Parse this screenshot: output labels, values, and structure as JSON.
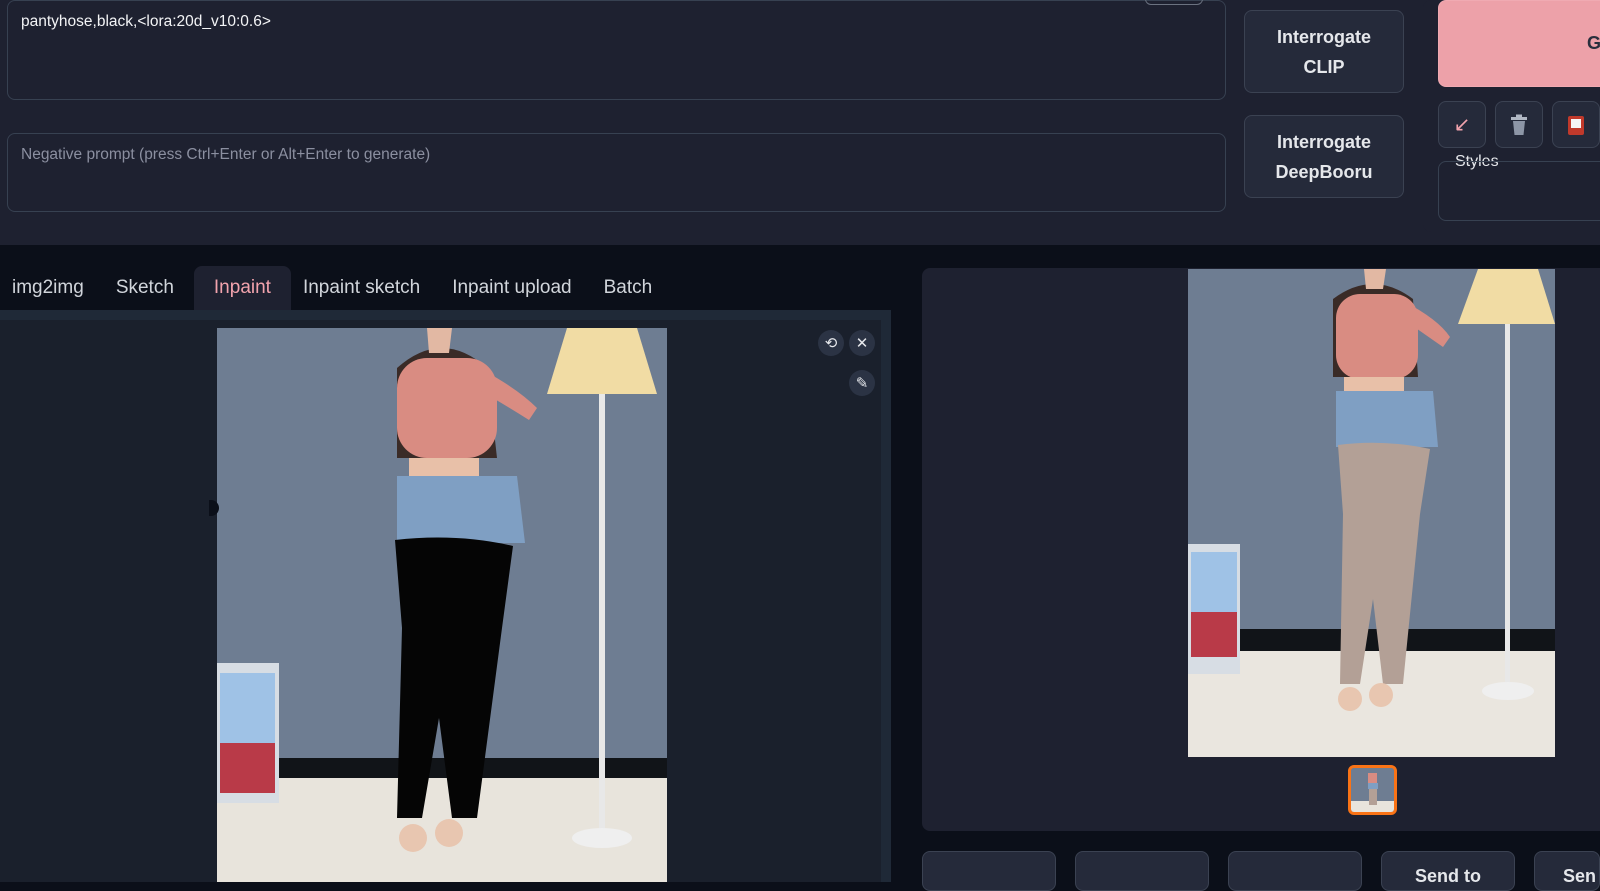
{
  "prompt": {
    "value": "pantyhose,black,<lora:20d_v10:0.6>"
  },
  "negative_prompt": {
    "placeholder": "Negative prompt (press Ctrl+Enter or Alt+Enter to generate)"
  },
  "interrogate": {
    "clip_label": "Interrogate\nCLIP",
    "deepbooru_label": "Interrogate\nDeepBooru"
  },
  "actions": {
    "generate_label": "Ge",
    "styles_label": "Styles"
  },
  "tool_icons": [
    "arrow-icon",
    "trash-icon",
    "clipboard-icon"
  ],
  "tabs": [
    {
      "label": "img2img",
      "active": false
    },
    {
      "label": "Sketch",
      "active": false
    },
    {
      "label": "Inpaint",
      "active": true
    },
    {
      "label": "Inpaint sketch",
      "active": false
    },
    {
      "label": "Inpaint upload",
      "active": false
    },
    {
      "label": "Batch",
      "active": false
    }
  ],
  "canvas": {
    "controls": [
      "undo-icon",
      "close-icon",
      "brush-icon"
    ]
  },
  "output": {
    "send_buttons": [
      "",
      "",
      "",
      "Send to",
      "Sen"
    ]
  },
  "colors": {
    "accent": "#eda1a9",
    "thumb_border": "#f97316",
    "background": "#0b0f19",
    "panel": "#1e2130"
  }
}
